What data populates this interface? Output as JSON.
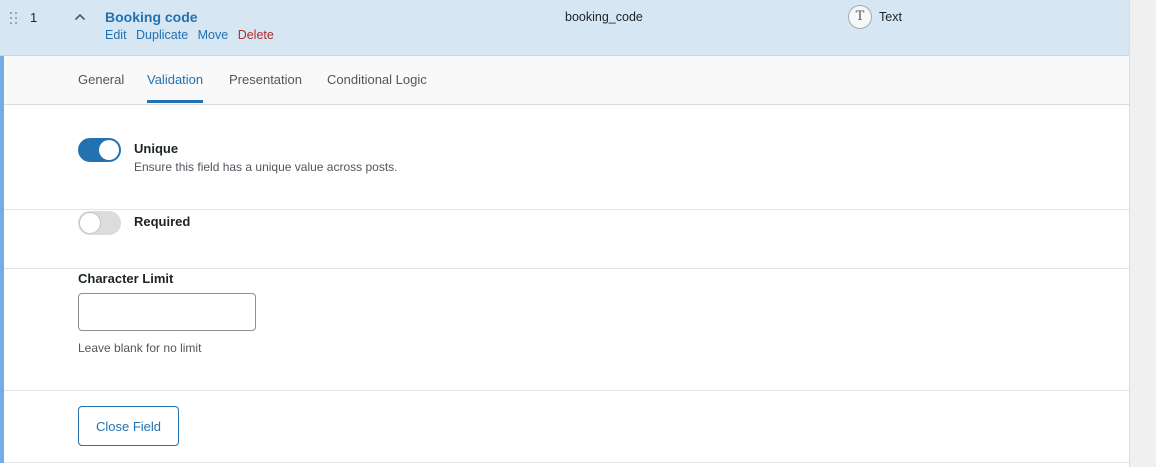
{
  "field": {
    "order": "1",
    "label": "Booking code",
    "name": "booking_code",
    "type_icon_glyph": "T",
    "type_label": "Text",
    "actions": {
      "edit": "Edit",
      "duplicate": "Duplicate",
      "move": "Move",
      "delete": "Delete"
    }
  },
  "tabs": [
    {
      "label": "General",
      "active": false
    },
    {
      "label": "Validation",
      "active": true
    },
    {
      "label": "Presentation",
      "active": false
    },
    {
      "label": "Conditional Logic",
      "active": false
    }
  ],
  "settings": {
    "unique": {
      "label": "Unique",
      "description": "Ensure this field has a unique value across posts.",
      "enabled": true
    },
    "required": {
      "label": "Required",
      "enabled": false
    },
    "character_limit": {
      "label": "Character Limit",
      "value": "",
      "help": "Leave blank for no limit"
    }
  },
  "close_button": "Close Field",
  "colors": {
    "accent": "#2271b1",
    "header_bg": "#d7e6f3",
    "delete": "#b32d2e",
    "left_bar": "#72aee6"
  },
  "icons": [
    "drag-handle-icon",
    "chevron-up-icon",
    "text-type-icon"
  ]
}
